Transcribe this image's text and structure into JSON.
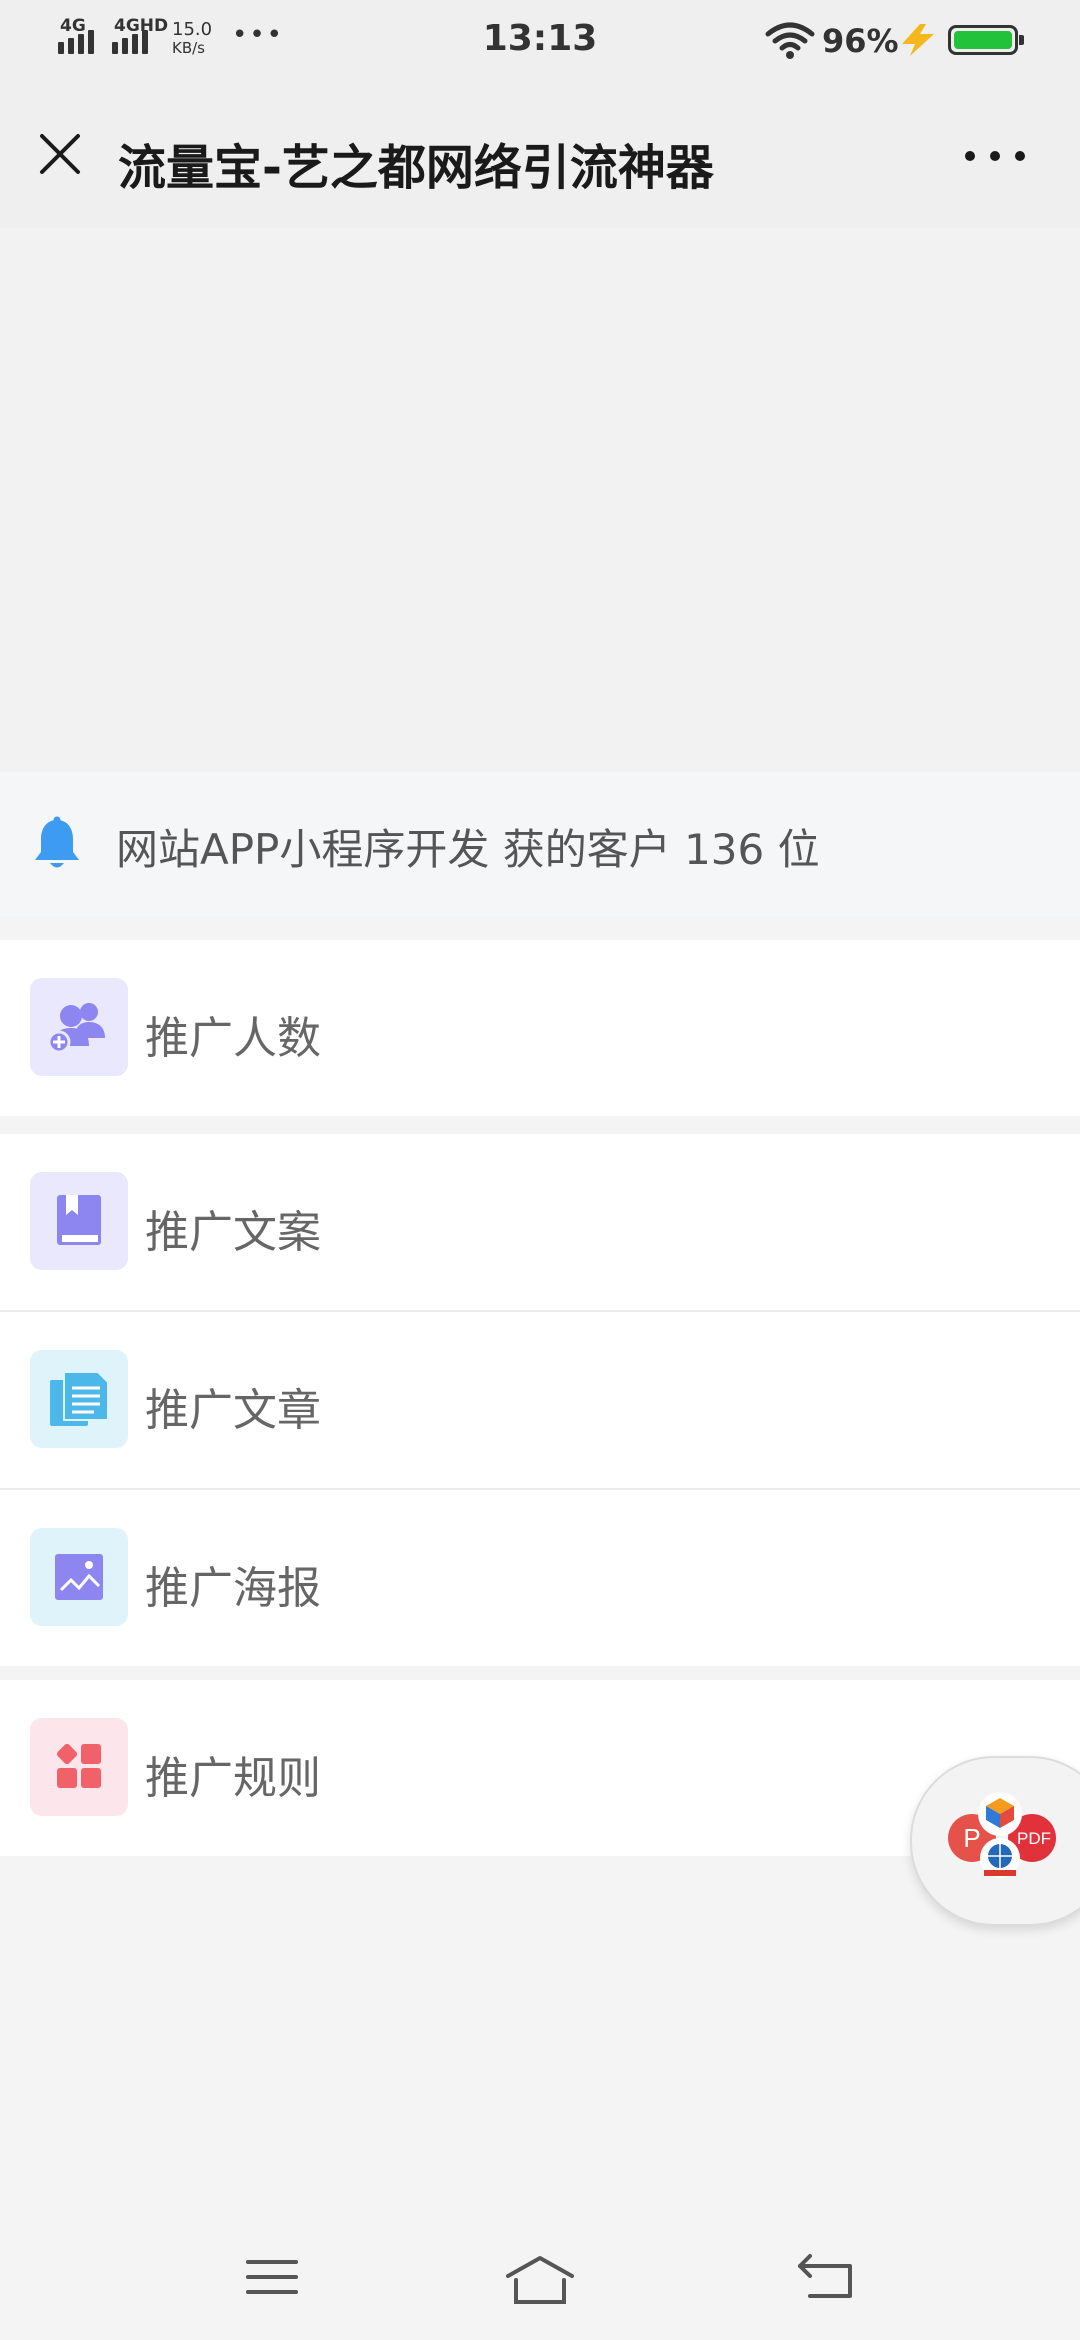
{
  "status_bar": {
    "sim1": "4G",
    "sim2": "4GHD",
    "speed_value": "15.0",
    "speed_unit": "KB/s",
    "more": "•••",
    "time": "13:13",
    "battery": "96%",
    "icons": [
      "signal-icon",
      "wifi-icon",
      "charging-icon",
      "battery-icon"
    ],
    "battery_color": "#22c23b"
  },
  "header": {
    "title": "流量宝-艺之都网络引流神器",
    "close_icon": "close-icon",
    "more_icon": "more-icon"
  },
  "notice": {
    "icon": "bell-icon",
    "text": "网站APP小程序开发 获的客户 136 位",
    "icon_color": "#3d9bf2"
  },
  "menu": {
    "groups": [
      {
        "items": [
          {
            "label": "推广人数",
            "icon": "users-icon",
            "icon_color": "#8d86f0",
            "bg_color": "#e9e8fc"
          }
        ]
      },
      {
        "items": [
          {
            "label": "推广文案",
            "icon": "book-icon",
            "icon_color": "#8d86f0",
            "bg_color": "#e9e8fc"
          },
          {
            "label": "推广文章",
            "icon": "document-icon",
            "icon_color": "#4cb8ea",
            "bg_color": "#dff3fb"
          },
          {
            "label": "推广海报",
            "icon": "image-icon",
            "icon_color": "#8d86f0",
            "bg_color": "#dff3fb"
          }
        ]
      },
      {
        "items": [
          {
            "label": "推广规则",
            "icon": "grid-icon",
            "icon_color": "#f0616a",
            "bg_color": "#fde5ec"
          }
        ]
      }
    ]
  },
  "floating_button": {
    "icon": "office-apps-icon",
    "badge_p": "P",
    "badge_pdf": "PDF"
  },
  "nav_bar": {
    "icons": [
      "menu-icon",
      "home-icon",
      "back-icon"
    ]
  }
}
